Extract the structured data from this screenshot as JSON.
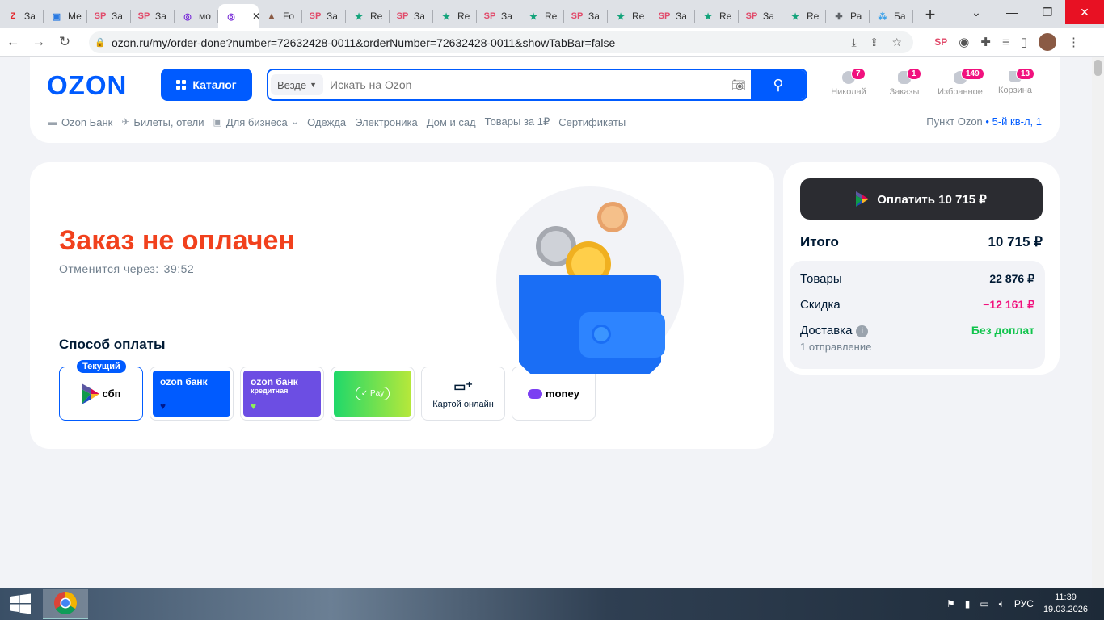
{
  "browser": {
    "tabs": [
      {
        "icon": "zen-icon",
        "label": "За",
        "color": "#e3282d",
        "glyph": "Z"
      },
      {
        "icon": "message-icon",
        "label": "Ме",
        "color": "#2a7ae2",
        "glyph": "▣"
      },
      {
        "icon": "sp-icon",
        "label": "За",
        "color": "#e14a6a",
        "glyph": "SP"
      },
      {
        "icon": "sp-icon",
        "label": "За",
        "color": "#e14a6a",
        "glyph": "SP"
      },
      {
        "icon": "ozon-ring-icon",
        "label": "мо",
        "color": "#7a2fd8",
        "glyph": "◎"
      },
      {
        "icon": "ozon-ring-icon",
        "label": "",
        "color": "#7a2fd8",
        "glyph": "◎",
        "active": true
      },
      {
        "icon": "photo-icon",
        "label": "Fo",
        "color": "#8a5a44",
        "glyph": "▲"
      },
      {
        "icon": "sp-icon",
        "label": "За",
        "color": "#e14a6a",
        "glyph": "SP"
      },
      {
        "icon": "star-icon",
        "label": "Re",
        "color": "#12a37a",
        "glyph": "★"
      },
      {
        "icon": "sp-icon",
        "label": "За",
        "color": "#e14a6a",
        "glyph": "SP"
      },
      {
        "icon": "star-icon",
        "label": "Re",
        "color": "#12a37a",
        "glyph": "★"
      },
      {
        "icon": "sp-icon",
        "label": "За",
        "color": "#e14a6a",
        "glyph": "SP"
      },
      {
        "icon": "star-icon",
        "label": "Re",
        "color": "#12a37a",
        "glyph": "★"
      },
      {
        "icon": "sp-icon",
        "label": "За",
        "color": "#e14a6a",
        "glyph": "SP"
      },
      {
        "icon": "star-icon",
        "label": "Re",
        "color": "#12a37a",
        "glyph": "★"
      },
      {
        "icon": "sp-icon",
        "label": "За",
        "color": "#e14a6a",
        "glyph": "SP"
      },
      {
        "icon": "star-icon",
        "label": "Re",
        "color": "#12a37a",
        "glyph": "★"
      },
      {
        "icon": "sp-icon",
        "label": "За",
        "color": "#e14a6a",
        "glyph": "SP"
      },
      {
        "icon": "star-icon",
        "label": "Re",
        "color": "#12a37a",
        "glyph": "★"
      },
      {
        "icon": "puzzle-icon",
        "label": "Ра",
        "color": "#5f6368",
        "glyph": "✚"
      },
      {
        "icon": "dots-icon",
        "label": "Ба",
        "color": "#3aa0e8",
        "glyph": "⁂"
      }
    ],
    "new_tab": "+",
    "url": "ozon.ru/my/order-done?number=72632428-0011&orderNumber=72632428-0011&showTabBar=false"
  },
  "header": {
    "logo": "OZON",
    "catalog": "Каталог",
    "search_scope": "Везде",
    "search_placeholder": "Искать на Ozon",
    "icons": [
      {
        "label": "Николай",
        "badge": "7"
      },
      {
        "label": "Заказы",
        "badge": "1"
      },
      {
        "label": "Избранное",
        "badge": "149"
      },
      {
        "label": "Корзина",
        "badge": "13"
      }
    ],
    "subnav": [
      "Ozon Банк",
      "Билеты, отели",
      "Для бизнеса",
      "Одежда",
      "Электроника",
      "Дом и сад",
      "Товары за 1₽",
      "Сертификаты"
    ],
    "pickup_label": "Пункт Ozon",
    "pickup_address": "5-й кв-л, 1"
  },
  "order": {
    "title": "Заказ не оплачен",
    "cancel_label": "Отменится через:",
    "cancel_timer": "39:52",
    "payment_title": "Способ оплаты",
    "current_badge": "Текущий",
    "methods": {
      "sbp": "сбп",
      "ozon_bank": "ozon банк",
      "ozon_credit": "ozon банк",
      "ozon_credit_sub": "кредитная",
      "pay": "Pay",
      "card_online": "Картой онлайн",
      "money": "money"
    }
  },
  "summary": {
    "pay_button": "Оплатить 10 715 ₽",
    "total_label": "Итого",
    "total_value": "10 715 ₽",
    "goods_label": "Товары",
    "goods_value": "22 876 ₽",
    "discount_label": "Скидка",
    "discount_value": "−12 161 ₽",
    "delivery_label": "Доставка",
    "delivery_value": "Без доплат",
    "shipments": "1 отправление"
  },
  "taskbar": {
    "lang": "РУС",
    "time": "11:39",
    "date": "19.03.2026"
  }
}
